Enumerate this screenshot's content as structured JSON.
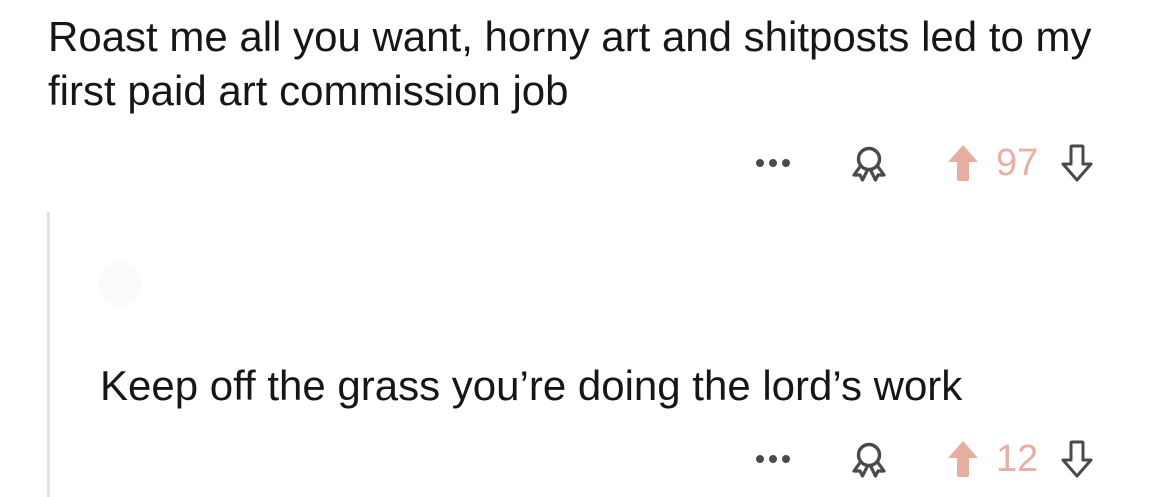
{
  "post": {
    "text": "Roast me all you want, horny art and shitposts led to my first paid art commission job",
    "actions": {
      "more_icon": "more-horizontal-icon",
      "award_icon": "award-icon",
      "upvote_icon": "upvote-arrow-icon",
      "vote_count": "97",
      "downvote_icon": "downvote-arrow-icon"
    }
  },
  "reply": {
    "username": "",
    "text": "Keep off the grass you’re doing the lord’s work",
    "actions": {
      "more_icon": "more-horizontal-icon",
      "award_icon": "award-icon",
      "upvote_icon": "upvote-arrow-icon",
      "vote_count": "12",
      "downvote_icon": "downvote-arrow-icon"
    }
  },
  "colors": {
    "upvote_active": "#e6ada1",
    "icon_gray": "#4a4a4a",
    "thread_line": "#e3e3e3"
  }
}
